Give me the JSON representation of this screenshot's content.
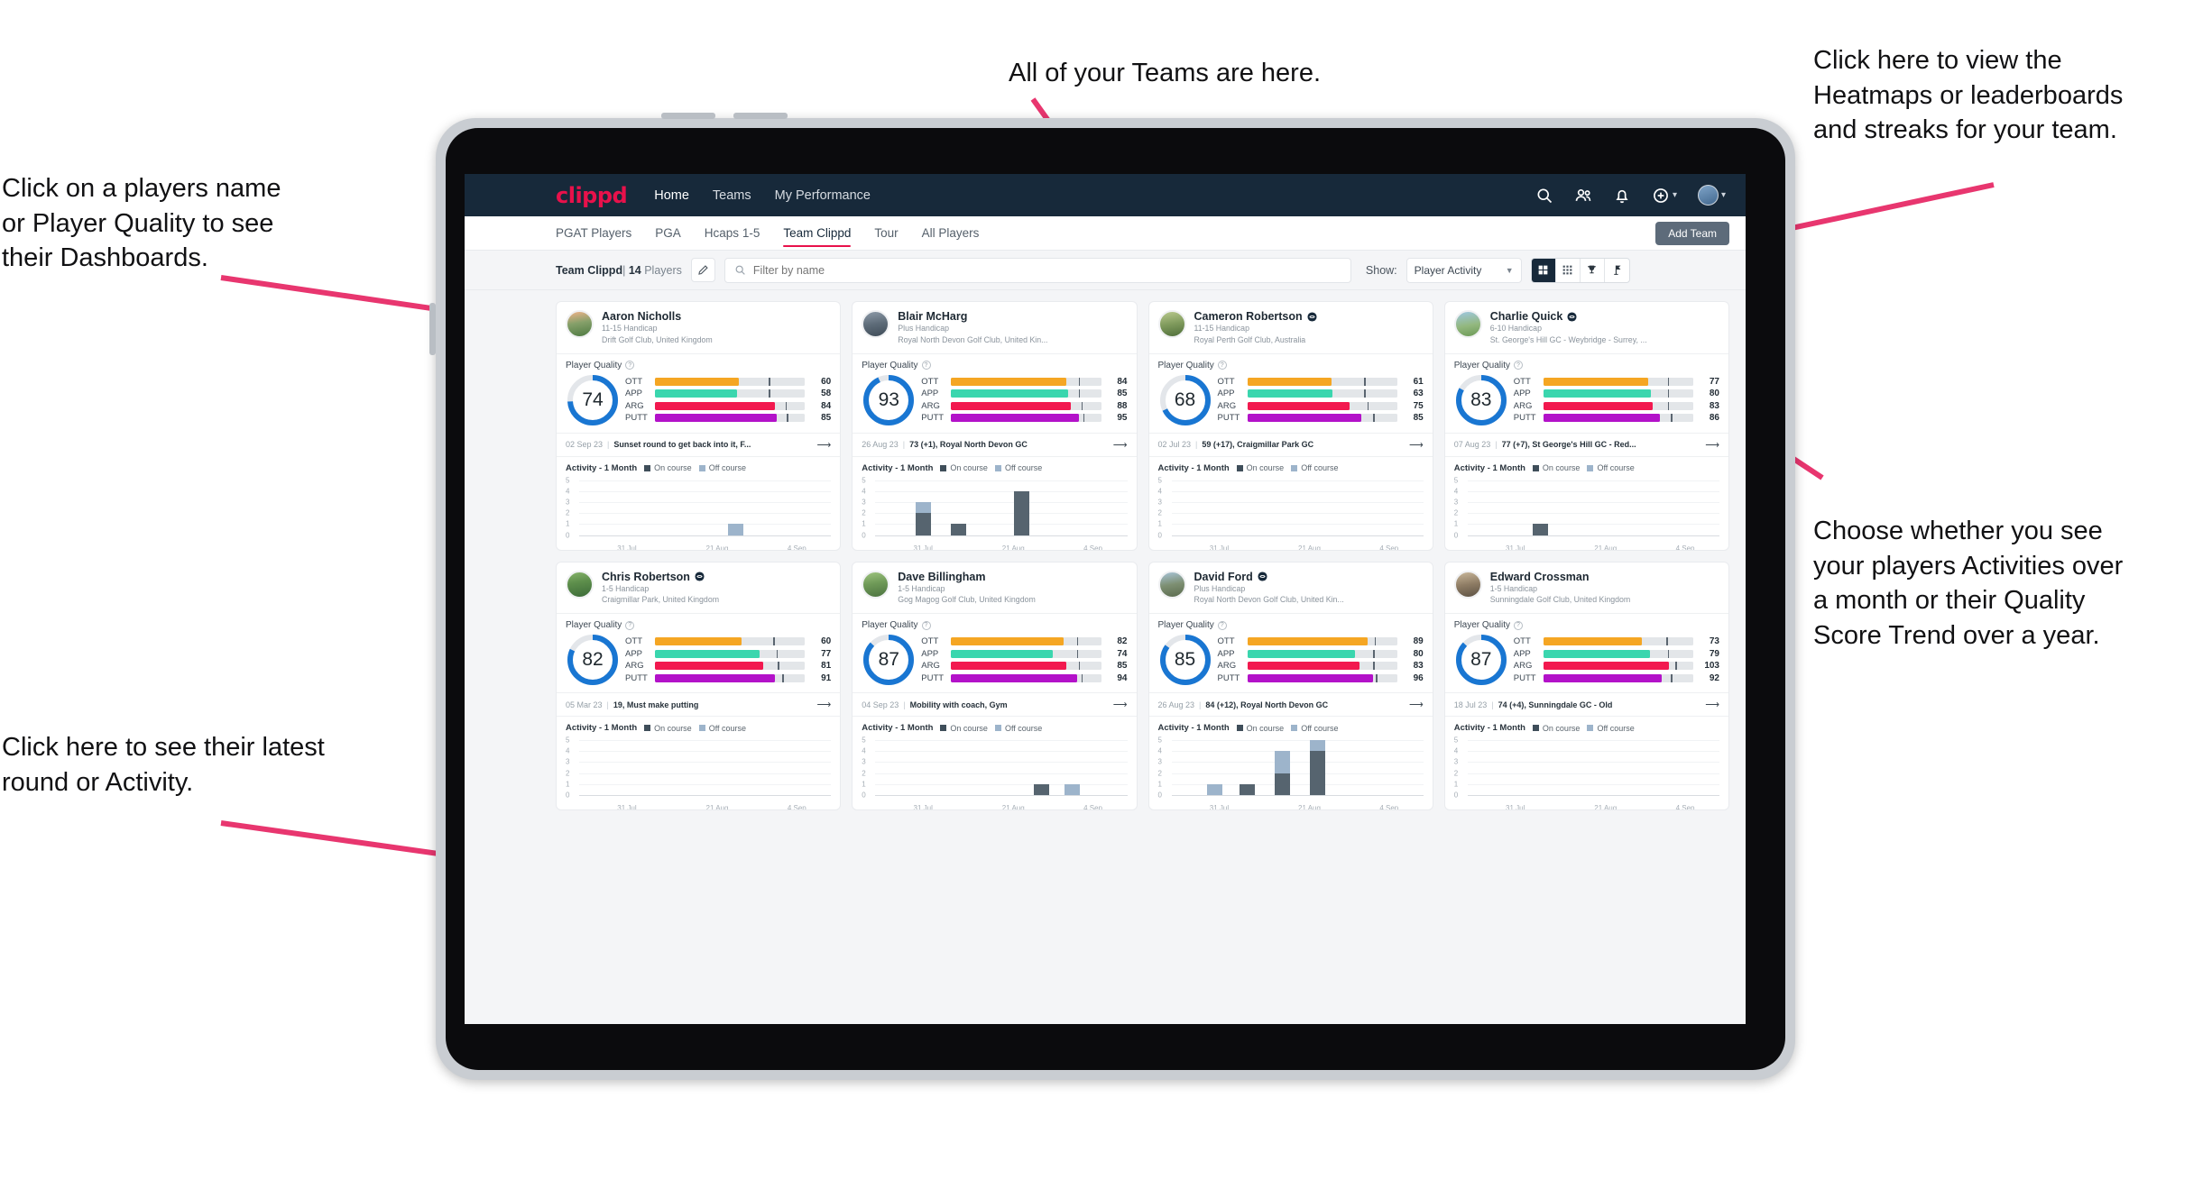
{
  "annotations": {
    "top": "All of your Teams are here.",
    "top_right": "Click here to view the\nHeatmaps or leaderboards\nand streaks for your team.",
    "top_left": "Click on a players name\nor Player Quality to see\ntheir Dashboards.",
    "right_mid": "Choose whether you see\nyour players Activities over\na month or their Quality\nScore Trend over a year.",
    "bottom_left": "Click here to see their latest\nround or Activity.",
    "arrow_color": "#e8366f"
  },
  "app": {
    "brand": "clippd",
    "nav_links": [
      {
        "label": "Home",
        "active": true
      },
      {
        "label": "Teams",
        "active": false
      },
      {
        "label": "My Performance",
        "active": false
      }
    ],
    "nav_icons": [
      "search-icon",
      "people-icon",
      "bell-icon",
      "plus-circle-icon",
      "avatar"
    ],
    "tabs": [
      {
        "label": "PGAT Players",
        "active": false
      },
      {
        "label": "PGA",
        "active": false
      },
      {
        "label": "Hcaps 1-5",
        "active": false
      },
      {
        "label": "Team Clippd",
        "active": true
      },
      {
        "label": "Tour",
        "active": false
      },
      {
        "label": "All Players",
        "active": false
      }
    ],
    "add_team_label": "Add Team",
    "filter": {
      "team_name": "Team Clippd",
      "separator": "|",
      "player_count": "14",
      "players_word": "Players",
      "edit_icon": "pencil-icon",
      "search_placeholder": "Filter by name",
      "search_value": "",
      "show_label": "Show:",
      "show_selected": "Player Activity",
      "show_options": [
        "Player Activity",
        "Quality Score Trend"
      ],
      "view_buttons": [
        "grid-large-icon",
        "grid-small-icon",
        "trophy-icon",
        "flag-icon"
      ],
      "view_selected_index": 0
    }
  },
  "theme": {
    "navbar_bg": "#17293a",
    "brand_color": "#e8114b",
    "accent": "#1976d2",
    "ott_color": "#f5a623",
    "app_color": "#3ad6ae",
    "arg_color": "#f2194f",
    "putt_color": "#b312c9",
    "on_course": "#56646f",
    "off_course": "#9db4cb"
  },
  "chart_common": {
    "title": "Activity - 1 Month",
    "legend": [
      "On course",
      "Off course"
    ],
    "y_ticks": [
      "5",
      "4",
      "3",
      "2",
      "1",
      "0"
    ],
    "ylim": [
      0,
      5
    ],
    "x_ticks": [
      "31 Jul",
      "21 Aug",
      "4 Sep"
    ],
    "type": "bar"
  },
  "metric_labels": [
    "OTT",
    "APP",
    "ARG",
    "PUTT"
  ],
  "players": [
    {
      "name": "Aaron Nicholls",
      "verified": false,
      "handicap": "11-15 Handicap",
      "club": "Drift Golf Club, United Kingdom",
      "avatar_css": "linear-gradient(170deg,#f0b38a 0%,#86a06a 45%,#4e7a42 100%)",
      "quality_label": "Player Quality",
      "quality_score": 74,
      "metrics": [
        {
          "label": "OTT",
          "value": 60,
          "fill_pct": 56,
          "tick_pct": 76
        },
        {
          "label": "APP",
          "value": 58,
          "fill_pct": 55,
          "tick_pct": 76
        },
        {
          "label": "ARG",
          "value": 84,
          "fill_pct": 80,
          "tick_pct": 87
        },
        {
          "label": "PUTT",
          "value": 85,
          "fill_pct": 81,
          "tick_pct": 88
        }
      ],
      "last_date": "02 Sep 23",
      "last_text": "Sunset round to get back into it, F...",
      "chart_data": {
        "type": "bar",
        "title": "Activity - 1 Month",
        "categories": [
          "31 Jul",
          "21 Aug",
          "4 Sep"
        ],
        "ylim": [
          0,
          5
        ],
        "series": [
          {
            "name": "On course",
            "values": [
              0
            ]
          },
          {
            "name": "Off course",
            "values": [
              1
            ]
          }
        ],
        "bars": [
          {
            "pos_pct": 59,
            "on": 0,
            "off": 1
          }
        ]
      }
    },
    {
      "name": "Blair McHarg",
      "verified": false,
      "handicap": "Plus Handicap",
      "club": "Royal North Devon Golf Club, United Kin...",
      "avatar_css": "linear-gradient(170deg,#8d9aa8 0%,#5d6b78 50%,#3f4c58 100%)",
      "quality_label": "Player Quality",
      "quality_score": 93,
      "metrics": [
        {
          "label": "OTT",
          "value": 84,
          "fill_pct": 77,
          "tick_pct": 85
        },
        {
          "label": "APP",
          "value": 85,
          "fill_pct": 78,
          "tick_pct": 85
        },
        {
          "label": "ARG",
          "value": 88,
          "fill_pct": 80,
          "tick_pct": 87
        },
        {
          "label": "PUTT",
          "value": 95,
          "fill_pct": 85,
          "tick_pct": 88
        }
      ],
      "last_date": "26 Aug 23",
      "last_text": "73 (+1), Royal North Devon GC",
      "chart_data": {
        "type": "bar",
        "title": "Activity - 1 Month",
        "categories": [
          "31 Jul",
          "21 Aug",
          "4 Sep"
        ],
        "ylim": [
          0,
          5
        ],
        "series": [
          {
            "name": "On course",
            "values": [
              2,
              1,
              4
            ]
          },
          {
            "name": "Off course",
            "values": [
              1,
              0,
              0
            ]
          }
        ],
        "bars": [
          {
            "pos_pct": 16,
            "on": 2,
            "off": 1
          },
          {
            "pos_pct": 30,
            "on": 1,
            "off": 0
          },
          {
            "pos_pct": 55,
            "on": 4,
            "off": 0
          }
        ]
      }
    },
    {
      "name": "Cameron Robertson",
      "verified": true,
      "handicap": "11-15 Handicap",
      "club": "Royal Perth Golf Club, Australia",
      "avatar_css": "linear-gradient(170deg,#b9c98e 0%,#7f9a5c 50%,#4f6e3a 100%)",
      "quality_label": "Player Quality",
      "quality_score": 68,
      "metrics": [
        {
          "label": "OTT",
          "value": 61,
          "fill_pct": 56,
          "tick_pct": 78
        },
        {
          "label": "APP",
          "value": 63,
          "fill_pct": 57,
          "tick_pct": 78
        },
        {
          "label": "ARG",
          "value": 75,
          "fill_pct": 68,
          "tick_pct": 80
        },
        {
          "label": "PUTT",
          "value": 85,
          "fill_pct": 76,
          "tick_pct": 84
        }
      ],
      "last_date": "02 Jul 23",
      "last_text": "59 (+17), Craigmillar Park GC",
      "chart_data": {
        "type": "bar",
        "title": "Activity - 1 Month",
        "categories": [
          "31 Jul",
          "21 Aug",
          "4 Sep"
        ],
        "ylim": [
          0,
          5
        ],
        "series": [
          {
            "name": "On course",
            "values": []
          },
          {
            "name": "Off course",
            "values": []
          }
        ],
        "bars": []
      }
    },
    {
      "name": "Charlie Quick",
      "verified": true,
      "handicap": "6-10 Handicap",
      "club": "St. George's Hill GC - Weybridge - Surrey, ...",
      "avatar_css": "linear-gradient(170deg,#9fc8e2 0%,#93b87f 55%,#6c9a56 100%)",
      "quality_label": "Player Quality",
      "quality_score": 83,
      "metrics": [
        {
          "label": "OTT",
          "value": 77,
          "fill_pct": 70,
          "tick_pct": 83
        },
        {
          "label": "APP",
          "value": 80,
          "fill_pct": 72,
          "tick_pct": 83
        },
        {
          "label": "ARG",
          "value": 83,
          "fill_pct": 73,
          "tick_pct": 83
        },
        {
          "label": "PUTT",
          "value": 86,
          "fill_pct": 78,
          "tick_pct": 85
        }
      ],
      "last_date": "07 Aug 23",
      "last_text": "77 (+7), St George's Hill GC - Red...",
      "chart_data": {
        "type": "bar",
        "title": "Activity - 1 Month",
        "categories": [
          "31 Jul",
          "21 Aug",
          "4 Sep"
        ],
        "ylim": [
          0,
          5
        ],
        "series": [
          {
            "name": "On course",
            "values": [
              1
            ]
          },
          {
            "name": "Off course",
            "values": [
              0
            ]
          }
        ],
        "bars": [
          {
            "pos_pct": 26,
            "on": 1,
            "off": 0
          }
        ]
      }
    },
    {
      "name": "Chris Robertson",
      "verified": true,
      "handicap": "1-5 Handicap",
      "club": "Craigmillar Park, United Kingdom",
      "avatar_css": "linear-gradient(170deg,#86b36a 0%,#5e8f4c 40%,#3c6b38 100%)",
      "quality_label": "Player Quality",
      "quality_score": 82,
      "metrics": [
        {
          "label": "OTT",
          "value": 60,
          "fill_pct": 58,
          "tick_pct": 79
        },
        {
          "label": "APP",
          "value": 77,
          "fill_pct": 70,
          "tick_pct": 81
        },
        {
          "label": "ARG",
          "value": 81,
          "fill_pct": 72,
          "tick_pct": 82
        },
        {
          "label": "PUTT",
          "value": 91,
          "fill_pct": 80,
          "tick_pct": 85
        }
      ],
      "last_date": "05 Mar 23",
      "last_text": "19, Must make putting",
      "chart_data": {
        "type": "bar",
        "title": "Activity - 1 Month",
        "categories": [
          "31 Jul",
          "21 Aug",
          "4 Sep"
        ],
        "ylim": [
          0,
          5
        ],
        "series": [
          {
            "name": "On course",
            "values": []
          },
          {
            "name": "Off course",
            "values": []
          }
        ],
        "bars": []
      }
    },
    {
      "name": "Dave Billingham",
      "verified": false,
      "handicap": "1-5 Handicap",
      "club": "Gog Magog Golf Club, United Kingdom",
      "avatar_css": "linear-gradient(170deg,#9ec47f 0%,#6f9a58 45%,#4c7340 100%)",
      "quality_label": "Player Quality",
      "quality_score": 87,
      "metrics": [
        {
          "label": "OTT",
          "value": 82,
          "fill_pct": 75,
          "tick_pct": 84
        },
        {
          "label": "APP",
          "value": 74,
          "fill_pct": 68,
          "tick_pct": 84
        },
        {
          "label": "ARG",
          "value": 85,
          "fill_pct": 77,
          "tick_pct": 85
        },
        {
          "label": "PUTT",
          "value": 94,
          "fill_pct": 84,
          "tick_pct": 87
        }
      ],
      "last_date": "04 Sep 23",
      "last_text": "Mobility with coach, Gym",
      "chart_data": {
        "type": "bar",
        "title": "Activity - 1 Month",
        "categories": [
          "31 Jul",
          "21 Aug",
          "4 Sep"
        ],
        "ylim": [
          0,
          5
        ],
        "series": [
          {
            "name": "On course",
            "values": [
              1,
              0
            ]
          },
          {
            "name": "Off course",
            "values": [
              0,
              1
            ]
          }
        ],
        "bars": [
          {
            "pos_pct": 63,
            "on": 1,
            "off": 0
          },
          {
            "pos_pct": 75,
            "on": 0,
            "off": 1
          }
        ]
      }
    },
    {
      "name": "David Ford",
      "verified": true,
      "handicap": "Plus Handicap",
      "club": "Royal North Devon Golf Club, United Kin...",
      "avatar_css": "linear-gradient(170deg,#a8c4d8 0%,#7d8f72 50%,#5b6b4e 100%)",
      "quality_label": "Player Quality",
      "quality_score": 85,
      "metrics": [
        {
          "label": "OTT",
          "value": 89,
          "fill_pct": 80,
          "tick_pct": 85
        },
        {
          "label": "APP",
          "value": 80,
          "fill_pct": 72,
          "tick_pct": 84
        },
        {
          "label": "ARG",
          "value": 83,
          "fill_pct": 75,
          "tick_pct": 84
        },
        {
          "label": "PUTT",
          "value": 96,
          "fill_pct": 84,
          "tick_pct": 86
        }
      ],
      "last_date": "26 Aug 23",
      "last_text": "84 (+12), Royal North Devon GC",
      "chart_data": {
        "type": "bar",
        "title": "Activity - 1 Month",
        "categories": [
          "31 Jul",
          "21 Aug",
          "4 Sep"
        ],
        "ylim": [
          0,
          5
        ],
        "series": [
          {
            "name": "On course",
            "values": [
              0,
              1,
              2,
              4
            ]
          },
          {
            "name": "Off course",
            "values": [
              1,
              0,
              2,
              1
            ]
          }
        ],
        "bars": [
          {
            "pos_pct": 14,
            "on": 0,
            "off": 1
          },
          {
            "pos_pct": 27,
            "on": 1,
            "off": 0
          },
          {
            "pos_pct": 41,
            "on": 2,
            "off": 2
          },
          {
            "pos_pct": 55,
            "on": 4,
            "off": 1
          }
        ]
      }
    },
    {
      "name": "Edward Crossman",
      "verified": false,
      "handicap": "1-5 Handicap",
      "club": "Sunningdale Golf Club, United Kingdom",
      "avatar_css": "linear-gradient(170deg,#c9b79a 0%,#8e7c64 50%,#5d5244 100%)",
      "quality_label": "Player Quality",
      "quality_score": 87,
      "metrics": [
        {
          "label": "OTT",
          "value": 73,
          "fill_pct": 66,
          "tick_pct": 82
        },
        {
          "label": "APP",
          "value": 79,
          "fill_pct": 71,
          "tick_pct": 83
        },
        {
          "label": "ARG",
          "value": 103,
          "fill_pct": 84,
          "tick_pct": 88
        },
        {
          "label": "PUTT",
          "value": 92,
          "fill_pct": 79,
          "tick_pct": 85
        }
      ],
      "last_date": "18 Jul 23",
      "last_text": "74 (+4), Sunningdale GC - Old",
      "chart_data": {
        "type": "bar",
        "title": "Activity - 1 Month",
        "categories": [
          "31 Jul",
          "21 Aug",
          "4 Sep"
        ],
        "ylim": [
          0,
          5
        ],
        "series": [
          {
            "name": "On course",
            "values": []
          },
          {
            "name": "Off course",
            "values": []
          }
        ],
        "bars": []
      }
    }
  ]
}
